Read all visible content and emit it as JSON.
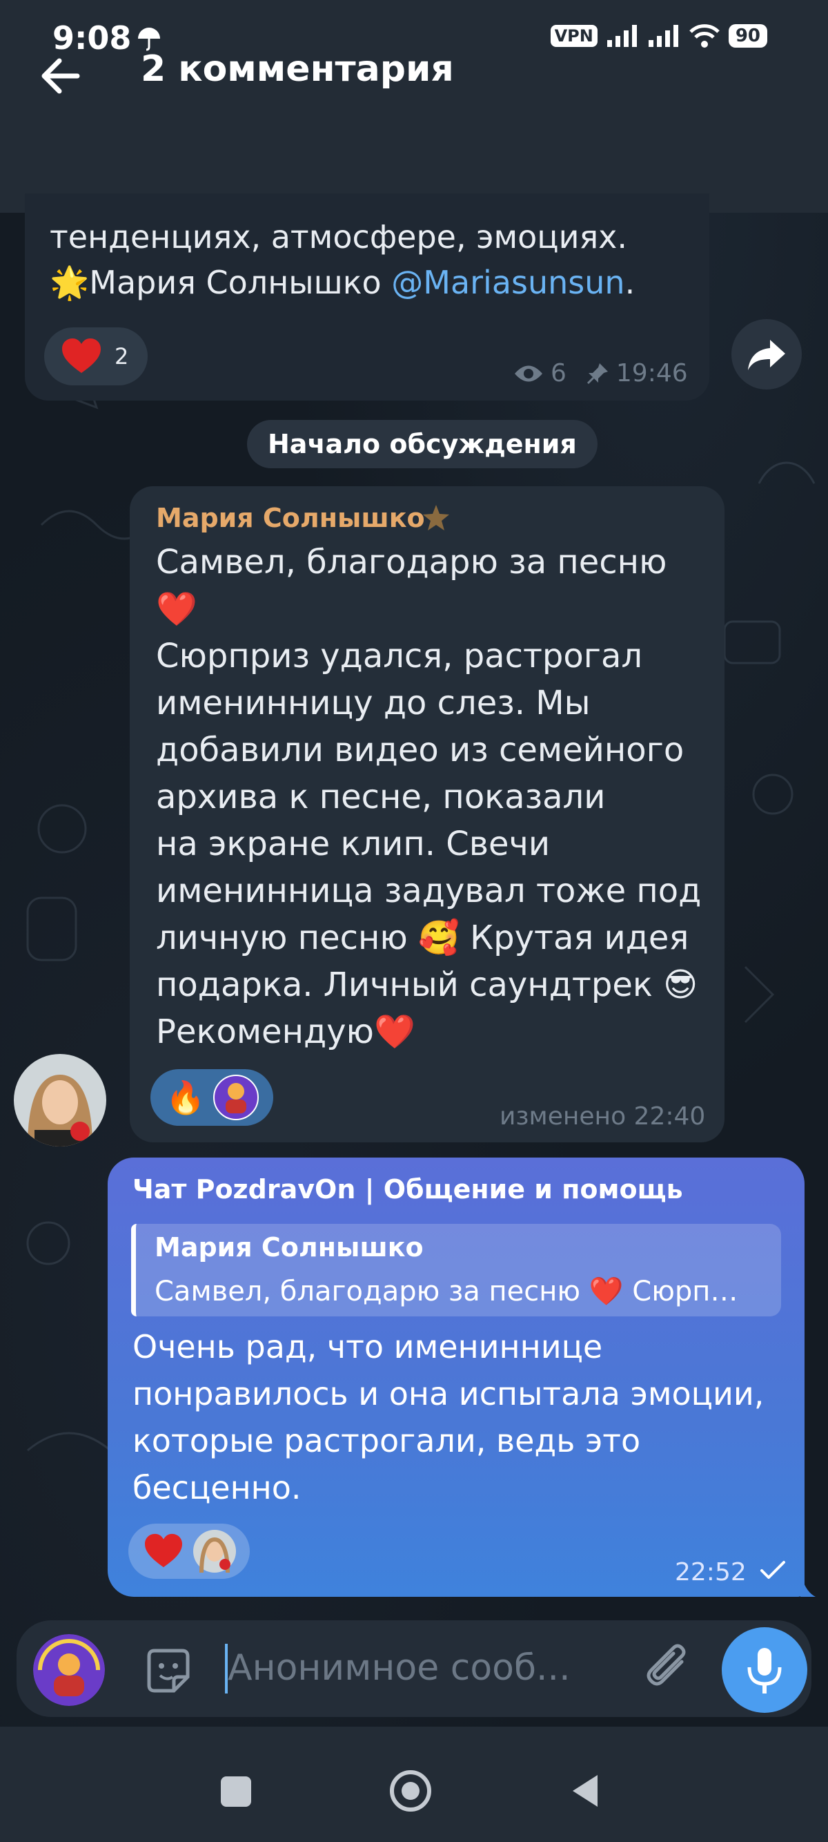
{
  "status_bar": {
    "time": "9:08",
    "vpn": "VPN",
    "battery": "90"
  },
  "header": {
    "title": "2 комментария"
  },
  "post": {
    "text_line1": "тенденциях, атмосфере, эмоциях.",
    "author_line_prefix": "Мария Солнышко ",
    "mention": "@Mariasunsun",
    "author_line_suffix": ".",
    "reaction_count": "2",
    "views": "6",
    "time": "19:46"
  },
  "service_message": "Начало обсуждения",
  "comment": {
    "author": "Мария Солнышко",
    "text": "Самвел, благодарю за песню\n❤️\nСюрприз удался, растрогал\nименинницу до слез. Мы\nдобавили видео из семейного\nархива к песне, показали\nна экране клип. Свечи\nименинница задувал тоже под\nличную песню 🥰 Крутая идея\nподарка.  Личный саундтрек 😎\nРекомендую❤️",
    "reaction_emoji": "🔥",
    "time": "изменено 22:40"
  },
  "reply": {
    "author": "Чат PozdravOn | Общение и помощь",
    "quote_name": "Мария Солнышко",
    "quote_text": "Самвел, благодарю за песню ❤️ Сюрп…",
    "text": "Очень рад, что имениннице понравилось и она испытала эмоции, которые растрогали, ведь это бесценно.",
    "reaction_emoji": "❤️",
    "time": "22:52"
  },
  "composer": {
    "placeholder": "Анонимное сооб..."
  },
  "colors": {
    "background": "#141b23",
    "bar": "#232c36",
    "incoming_bubble": "#242e39",
    "outgoing_bubble": "#4a78d6",
    "accent": "#4b9df0",
    "mention": "#6ab3f3",
    "author_name": "#e6a96a"
  }
}
